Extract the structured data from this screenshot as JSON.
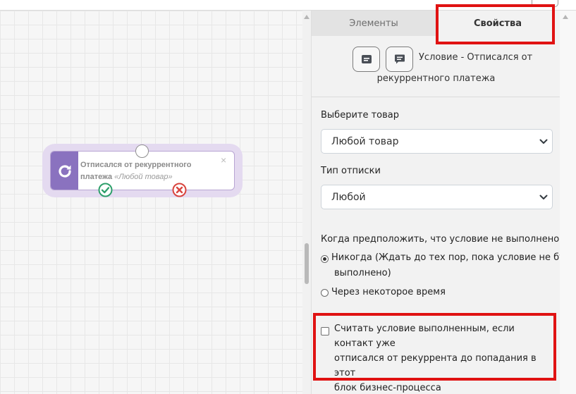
{
  "tabs": {
    "elements": "Элементы",
    "properties": "Свойства",
    "active": "properties"
  },
  "node": {
    "title": "Отписался от рекуррентного платежа",
    "subtitle": "«Любой товар»",
    "close": "×"
  },
  "panel": {
    "condition_title_line1": "Условие - Отписался от",
    "condition_title_line2": "рекуррентного платежа",
    "product_label": "Выберите товар",
    "product_value": "Любой товар",
    "unsub_type_label": "Тип отписки",
    "unsub_type_value": "Любой",
    "question": "Когда предположить, что условие не выполнено?",
    "radio_never_line1": "Никогда (Ждать до тех пор, пока условие не будет",
    "radio_never_line2": "выполнено)",
    "radio_never_checked": true,
    "radio_time": "Через некоторое время",
    "checkbox_line1": "Считать условие выполненным, если контакт уже",
    "checkbox_line2": "отписался от рекуррента до попадания в этот",
    "checkbox_line3": "блок бизнес-процесса",
    "checkbox_checked": false
  },
  "colors": {
    "node_accent": "#8a72bf",
    "node_halo": "#e4daf0",
    "port_yes": "#2e9f6b",
    "port_no": "#d9443e",
    "highlight": "#e01212"
  },
  "icons": {
    "node": "refresh-icon",
    "head_btn_1": "card-icon",
    "head_btn_2": "comment-icon",
    "port_yes": "check-circle-icon",
    "port_no": "x-circle-icon",
    "select": "chevron-down-icon"
  }
}
